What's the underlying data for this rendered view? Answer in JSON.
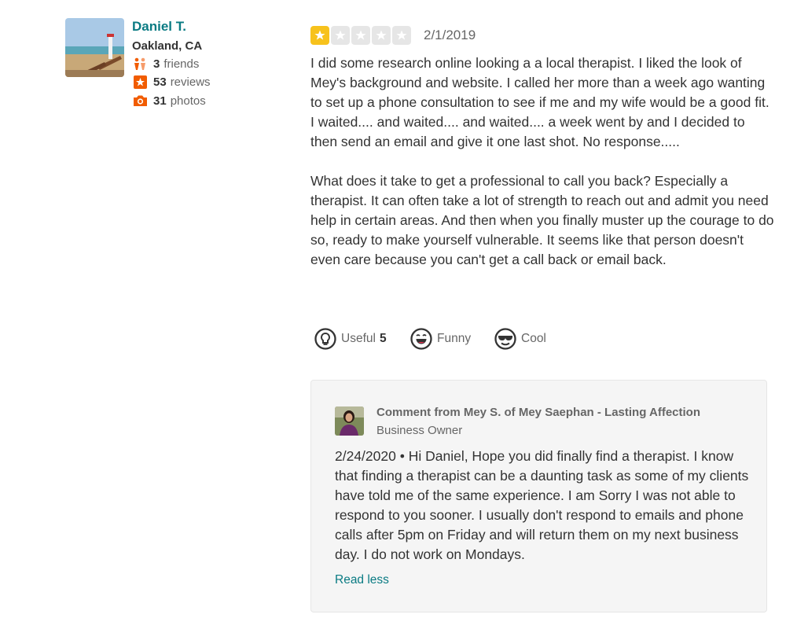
{
  "user": {
    "name": "Daniel T.",
    "location": "Oakland, CA",
    "friends_count": "3",
    "friends_label": "friends",
    "reviews_count": "53",
    "reviews_label": "reviews",
    "photos_count": "31",
    "photos_label": "photos"
  },
  "review": {
    "rating": 1,
    "max_rating": 5,
    "date": "2/1/2019",
    "text": "I did some research online looking a a local therapist. I liked the look of Mey's background and website. I called her more than a week ago wanting to set up a phone consultation to see if me and my wife would be a good fit. I waited.... and waited.... and waited.... a week went by and I decided to then send an email and give it one last shot. No response.....\n\nWhat does it take to get a professional to call you back? Especially a therapist. It can often take a lot of strength to reach out and admit you need help in certain areas. And then when you finally muster up the courage to do so, ready to make yourself vulnerable. It seems like that person doesn't even care because you can't get a call back or email back."
  },
  "votes": {
    "useful_label": "Useful",
    "useful_count": "5",
    "funny_label": "Funny",
    "cool_label": "Cool"
  },
  "owner_comment": {
    "header": "Comment from Mey S. of Mey Saephan - Lasting Affection",
    "role": "Business Owner",
    "body": "2/24/2020 • Hi Daniel, Hope you did finally find a therapist. I know that finding a therapist can be a daunting task as some of my clients have told me of the same experience. I am Sorry I was not able to respond to you sooner. I usually don't respond to emails and phone calls after 5pm on Friday and will return them on my next business day. I do not work on Mondays.",
    "read_less": "Read less"
  },
  "colors": {
    "link": "#0a7b83",
    "star_active": "#f7c21c",
    "star_inactive": "#e6e6e6",
    "stat_icon": "#f15c00"
  },
  "icons": [
    "friends-icon",
    "review-star-icon",
    "camera-icon",
    "lightbulb-icon",
    "funny-face-icon",
    "cool-face-icon"
  ]
}
